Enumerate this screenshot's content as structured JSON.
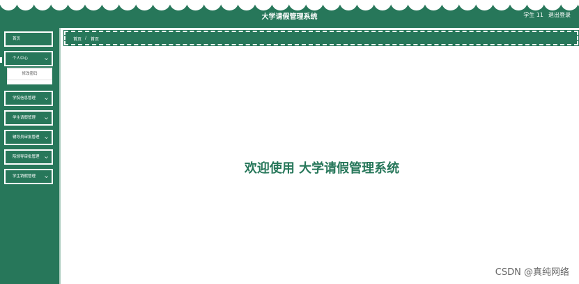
{
  "header": {
    "title": "大学请假管理系统",
    "user": "学生 11",
    "logout": "退出登录"
  },
  "sidebar": {
    "items": [
      {
        "label": "首页"
      },
      {
        "label": "个人中心",
        "submenu": [
          "修改密码"
        ]
      },
      {
        "label": "学院信息管理"
      },
      {
        "label": "学生请假管理"
      },
      {
        "label": "辅导员审批管理"
      },
      {
        "label": "院领导审批管理"
      },
      {
        "label": "学生销假管理"
      }
    ]
  },
  "breadcrumb": {
    "home": "首页",
    "separator": "/",
    "current": "首页"
  },
  "main": {
    "welcome": "欢迎使用 大学请假管理系统"
  },
  "watermark": "CSDN @真纯网络",
  "colors": {
    "primary": "#27775a",
    "background": "#ffffff"
  }
}
